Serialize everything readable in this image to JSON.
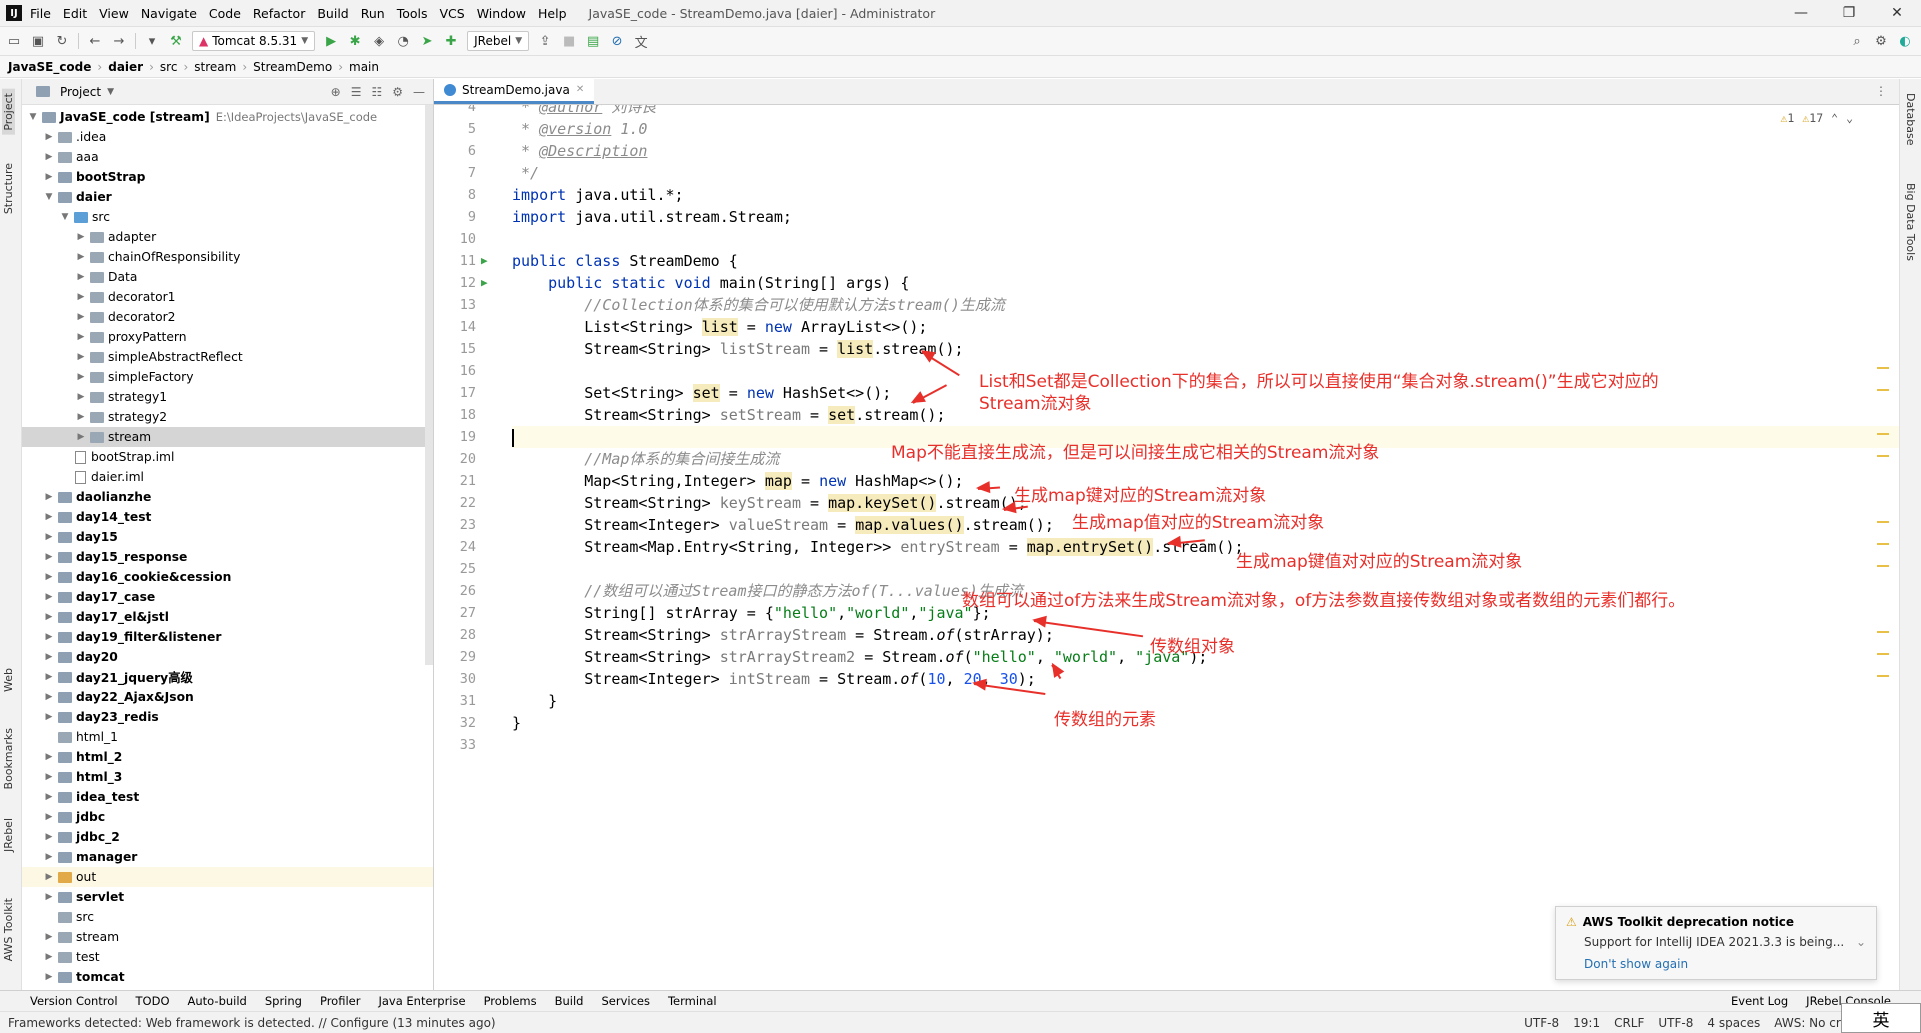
{
  "titlebar": {
    "menu": [
      "File",
      "Edit",
      "View",
      "Navigate",
      "Code",
      "Refactor",
      "Build",
      "Run",
      "Tools",
      "VCS",
      "Window",
      "Help"
    ],
    "title": "JavaSE_code - StreamDemo.java [daier] - Administrator",
    "min": "—",
    "max": "❐",
    "close": "✕"
  },
  "toolbar": {
    "run_config": "Tomcat 8.5.31",
    "jrebel": "JRebel"
  },
  "breadcrumb": [
    "JavaSE_code",
    "daier",
    "src",
    "stream",
    "StreamDemo",
    "main"
  ],
  "side_tabs_left": [
    "Project",
    "Structure",
    "Web",
    "Bookmarks",
    "JRebel",
    "AWS Toolkit"
  ],
  "side_tabs_right": [
    "Database",
    "Big Data Tools"
  ],
  "project": {
    "header": "Project",
    "root": {
      "name": "JavaSE_code [stream]",
      "path": "E:\\IdeaProjects\\JavaSE_code"
    },
    "tree": [
      {
        "name": ".idea",
        "level": 1,
        "type": "folder"
      },
      {
        "name": "aaa",
        "level": 1,
        "type": "folder"
      },
      {
        "name": "bootStrap",
        "level": 1,
        "type": "module"
      },
      {
        "name": "daier",
        "level": 1,
        "type": "module",
        "open": true
      },
      {
        "name": "src",
        "level": 2,
        "type": "src",
        "open": true
      },
      {
        "name": "adapter",
        "level": 3,
        "type": "folder"
      },
      {
        "name": "chainOfResponsibility",
        "level": 3,
        "type": "folder"
      },
      {
        "name": "Data",
        "level": 3,
        "type": "folder"
      },
      {
        "name": "decorator1",
        "level": 3,
        "type": "folder"
      },
      {
        "name": "decorator2",
        "level": 3,
        "type": "folder"
      },
      {
        "name": "proxyPattern",
        "level": 3,
        "type": "folder"
      },
      {
        "name": "simpleAbstractReflect",
        "level": 3,
        "type": "folder"
      },
      {
        "name": "simpleFactory",
        "level": 3,
        "type": "folder"
      },
      {
        "name": "strategy1",
        "level": 3,
        "type": "folder"
      },
      {
        "name": "strategy2",
        "level": 3,
        "type": "folder"
      },
      {
        "name": "stream",
        "level": 3,
        "type": "folder",
        "selected": true
      },
      {
        "name": "bootStrap.iml",
        "level": 2,
        "type": "file"
      },
      {
        "name": "daier.iml",
        "level": 2,
        "type": "file"
      },
      {
        "name": "daolianzhe",
        "level": 1,
        "type": "module"
      },
      {
        "name": "day14_test",
        "level": 1,
        "type": "module"
      },
      {
        "name": "day15",
        "level": 1,
        "type": "module"
      },
      {
        "name": "day15_response",
        "level": 1,
        "type": "module"
      },
      {
        "name": "day16_cookie&cession",
        "level": 1,
        "type": "module"
      },
      {
        "name": "day17_case",
        "level": 1,
        "type": "module"
      },
      {
        "name": "day17_el&jstl",
        "level": 1,
        "type": "module"
      },
      {
        "name": "day19_filter&listener",
        "level": 1,
        "type": "module"
      },
      {
        "name": "day20",
        "level": 1,
        "type": "module"
      },
      {
        "name": "day21_jquery高级",
        "level": 1,
        "type": "module"
      },
      {
        "name": "day22_Ajax&Json",
        "level": 1,
        "type": "module"
      },
      {
        "name": "day23_redis",
        "level": 1,
        "type": "module"
      },
      {
        "name": "html_1",
        "level": 1,
        "type": "folder",
        "nochev": true
      },
      {
        "name": "html_2",
        "level": 1,
        "type": "module"
      },
      {
        "name": "html_3",
        "level": 1,
        "type": "module"
      },
      {
        "name": "idea_test",
        "level": 1,
        "type": "module"
      },
      {
        "name": "jdbc",
        "level": 1,
        "type": "module"
      },
      {
        "name": "jdbc_2",
        "level": 1,
        "type": "module"
      },
      {
        "name": "manager",
        "level": 1,
        "type": "module"
      },
      {
        "name": "out",
        "level": 1,
        "type": "out"
      },
      {
        "name": "servlet",
        "level": 1,
        "type": "module"
      },
      {
        "name": "src",
        "level": 1,
        "type": "folder",
        "nochev": true
      },
      {
        "name": "stream",
        "level": 1,
        "type": "folder",
        "plain": true
      },
      {
        "name": "test",
        "level": 1,
        "type": "folder",
        "plain": true
      },
      {
        "name": "tomcat",
        "level": 1,
        "type": "module"
      }
    ]
  },
  "editor": {
    "tab": "StreamDemo.java",
    "warnings": {
      "a": "1",
      "b": "17"
    },
    "lines": [
      {
        "n": "4",
        "h": "<span class=\"cm\"> * </span><span class=\"dc\">@author</span><span class=\"cm\"> 刘诗良</span>"
      },
      {
        "n": "5",
        "h": "<span class=\"cm\"> * </span><span class=\"dc\">@version</span><span class=\"cm\"> 1.0</span>"
      },
      {
        "n": "6",
        "h": "<span class=\"cm\"> * </span><span class=\"dc\">@Description</span>"
      },
      {
        "n": "7",
        "h": "<span class=\"cm\"> */</span>"
      },
      {
        "n": "8",
        "h": "<span class=\"kw\">import</span> java.util.*;"
      },
      {
        "n": "9",
        "h": "<span class=\"kw\">import</span> java.util.stream.Stream;"
      },
      {
        "n": "10",
        "h": ""
      },
      {
        "n": "11",
        "h": "<span class=\"kw\">public class</span> StreamDemo {",
        "run": true
      },
      {
        "n": "12",
        "h": "    <span class=\"kw\">public static void</span> main(String[] args) {",
        "run": true
      },
      {
        "n": "13",
        "h": "        <span class=\"cm\">//Collection体系的集合可以使用默认方法stream()生成流</span>"
      },
      {
        "n": "14",
        "h": "        List&lt;String&gt; <span class=\"hl\">list</span> = <span class=\"kw\">new</span> ArrayList&lt;&gt;();"
      },
      {
        "n": "15",
        "h": "        Stream&lt;String&gt; <span class=\"gv\">listStream</span> = <span class=\"hl\">list</span>.stream();"
      },
      {
        "n": "16",
        "h": ""
      },
      {
        "n": "17",
        "h": "        Set&lt;String&gt; <span class=\"hl\">set</span> = <span class=\"kw\">new</span> HashSet&lt;&gt;();"
      },
      {
        "n": "18",
        "h": "        Stream&lt;String&gt; <span class=\"gv\">setStream</span> = <span class=\"hl\">set</span>.stream();"
      },
      {
        "n": "19",
        "h": "",
        "cur": true
      },
      {
        "n": "20",
        "h": "        <span class=\"cm\">//Map体系的集合间接生成流</span>"
      },
      {
        "n": "21",
        "h": "        Map&lt;String,Integer&gt; <span class=\"hl\">map</span> = <span class=\"kw\">new</span> HashMap&lt;&gt;();"
      },
      {
        "n": "22",
        "h": "        Stream&lt;String&gt; <span class=\"gv\">keyStream</span> = <span class=\"hl\">map.keySet()</span>.stream();"
      },
      {
        "n": "23",
        "h": "        Stream&lt;Integer&gt; <span class=\"gv\">valueStream</span> = <span class=\"hl\">map.values()</span>.stream();"
      },
      {
        "n": "24",
        "h": "        Stream&lt;Map.Entry&lt;String, Integer&gt;&gt; <span class=\"gv\">entryStream</span> = <span class=\"hl\">map.entrySet()</span>.stream();"
      },
      {
        "n": "25",
        "h": ""
      },
      {
        "n": "26",
        "h": "        <span class=\"cm\">//数组可以通过Stream接口的静态方法of(T...values)生成流</span>"
      },
      {
        "n": "27",
        "h": "        String[] strArray = {<span class=\"st\">\"hello\"</span>,<span class=\"st\">\"world\"</span>,<span class=\"st\">\"java\"</span>};"
      },
      {
        "n": "28",
        "h": "        Stream&lt;String&gt; <span class=\"gv\">strArrayStream</span> = Stream.<span class=\"it\">of</span>(strArray);"
      },
      {
        "n": "29",
        "h": "        Stream&lt;String&gt; <span class=\"gv\">strArrayStream2</span> = Stream.<span class=\"it\">of</span>(<span class=\"st\">\"hello\"</span>, <span class=\"st\">\"world\"</span>, <span class=\"st\">\"java\"</span>);"
      },
      {
        "n": "30",
        "h": "        Stream&lt;Integer&gt; <span class=\"gv\">intStream</span> = Stream.<span class=\"it\">of</span>(<span class=\"nu\">10</span>, <span class=\"nu\">20</span>, <span class=\"nu\">30</span>);"
      },
      {
        "n": "31",
        "h": "    }"
      },
      {
        "n": "32",
        "h": "}"
      },
      {
        "n": "33",
        "h": ""
      }
    ]
  },
  "annotations": [
    "List和Set都是Collection下的集合，所以可以直接使用“集合对象.stream()”生成它对应的",
    "Stream流对象",
    "Map不能直接生成流，但是可以间接生成它相关的Stream流对象",
    "生成map键对应的Stream流对象",
    "生成map值对应的Stream流对象",
    "生成map键值对对应的Stream流对象",
    "数组可以通过of方法来生成Stream流对象，of方法参数直接传数组对象或者数组的元素们都行。",
    "传数组对象",
    "传数组的元素"
  ],
  "annotation_color": "#e8302b",
  "notice": {
    "title": "AWS Toolkit deprecation notice",
    "body": "Support for IntelliJ IDEA 2021.3.3 is being...",
    "link": "Don't show again"
  },
  "tool_windows": [
    "Version Control",
    "TODO",
    "Auto-build",
    "Spring",
    "Profiler",
    "Java Enterprise",
    "Problems",
    "Build",
    "Services",
    "Terminal"
  ],
  "tool_windows_right": [
    "Event Log",
    "JRebel Console"
  ],
  "status": {
    "left": "Frameworks detected: Web framework is detected. // Configure (13 minutes ago)",
    "right": [
      "UTF-8",
      "19:1",
      "CRLF",
      "UTF-8",
      "4 spaces",
      "AWS: No credentials se"
    ]
  },
  "ime": "英"
}
